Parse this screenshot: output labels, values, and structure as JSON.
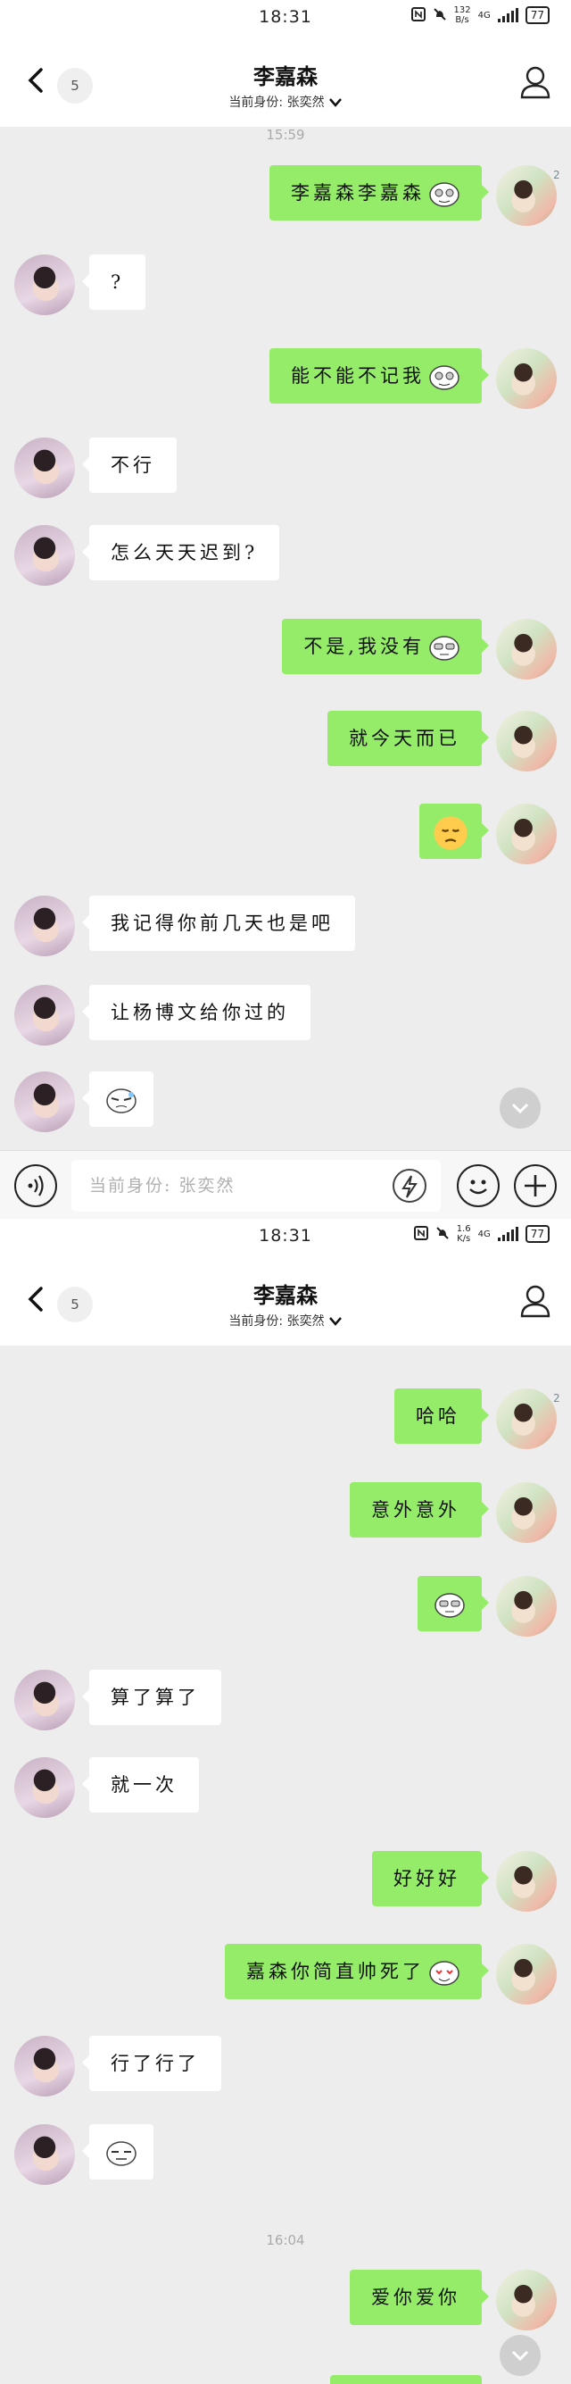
{
  "status": {
    "time": "18:31",
    "net_top_1": "132",
    "net_bottom_1": "B/s",
    "net_top_2": "1.6",
    "net_bottom_2": "K/s",
    "cell": "4G",
    "battery": "77"
  },
  "header": {
    "title": "李嘉森",
    "identity": "当前身份: 张奕然",
    "unread_count": "5"
  },
  "screen1": {
    "timestamp": "15:59",
    "messages": [
      {
        "side": "right",
        "text": "李嘉森李嘉森",
        "emoji": true,
        "mini": "2"
      },
      {
        "side": "left",
        "text": "?"
      },
      {
        "side": "right",
        "text": "能不能不记我",
        "emoji": true
      },
      {
        "side": "left",
        "text": "不行"
      },
      {
        "side": "left",
        "text": "怎么天天迟到?"
      },
      {
        "side": "right",
        "text": "不是,我没有",
        "emoji": true
      },
      {
        "side": "right",
        "text": "就今天而已"
      },
      {
        "side": "right",
        "text": "",
        "emoji_face": true
      },
      {
        "side": "left",
        "text": "我记得你前几天也是吧"
      },
      {
        "side": "left",
        "text": "让杨博文给你过的"
      },
      {
        "side": "left",
        "text": "",
        "emoji": true
      }
    ],
    "input_placeholder": "当前身份: 张奕然"
  },
  "screen2": {
    "timestamp": "16:04",
    "messages": [
      {
        "side": "right",
        "text": "哈哈",
        "mini": "2"
      },
      {
        "side": "right",
        "text": "意外意外"
      },
      {
        "side": "right",
        "text": "",
        "emoji": true
      },
      {
        "side": "left",
        "text": "算了算了"
      },
      {
        "side": "left",
        "text": "就一次"
      },
      {
        "side": "right",
        "text": "好好好"
      },
      {
        "side": "right",
        "text": "嘉森你简直帅死了",
        "emoji": true
      },
      {
        "side": "left",
        "text": "行了行了"
      },
      {
        "side": "left",
        "text": "",
        "emoji": true
      },
      {
        "side": "right",
        "text": "爱你爱你"
      }
    ]
  },
  "colors": {
    "right_bubble": "#95ec69",
    "left_bubble": "#ffffff",
    "background": "#ededed"
  }
}
